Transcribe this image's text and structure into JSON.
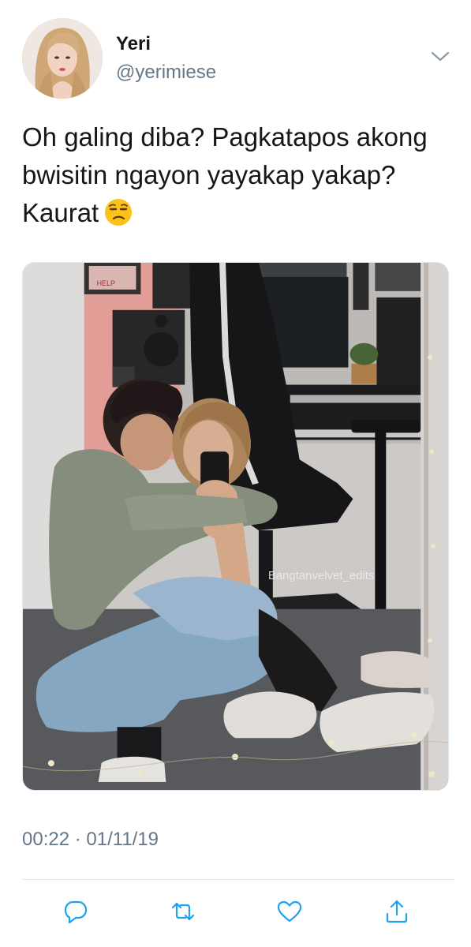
{
  "author": {
    "name": "Yeri",
    "handle": "@yerimiese"
  },
  "tweet": {
    "text": "Oh galing diba? Pagkatapos akong bwisitin ngayon yayakap yakap? Kaurat",
    "emoji": "unamused-face",
    "timestamp": "00:22 · 01/11/19"
  },
  "media": {
    "watermark": "Bangtanvelvet_edits",
    "sign_text": "HELP"
  },
  "actions": {
    "reply_icon": "reply-icon",
    "retweet_icon": "retweet-icon",
    "like_icon": "heart-icon",
    "share_icon": "share-icon"
  },
  "colors": {
    "text_primary": "#14171a",
    "text_secondary": "#657786",
    "icon": "#1da1f2",
    "divider": "#e1e8ed"
  }
}
